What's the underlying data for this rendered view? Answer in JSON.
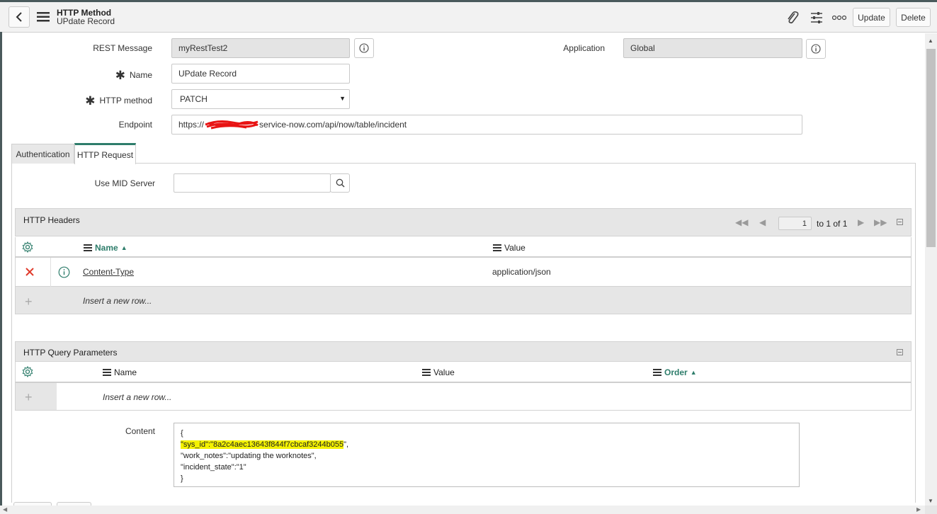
{
  "header": {
    "title": "HTTP Method",
    "subtitle": "UPdate Record",
    "update_label": "Update",
    "delete_label": "Delete"
  },
  "form": {
    "rest_message_label": "REST Message",
    "rest_message_value": "myRestTest2",
    "application_label": "Application",
    "application_value": "Global",
    "name_label": "Name",
    "name_value": "UPdate Record",
    "http_method_label": "HTTP method",
    "http_method_value": "PATCH",
    "endpoint_label": "Endpoint",
    "endpoint_prefix": "https://",
    "endpoint_suffix": "service-now.com/api/now/table/incident"
  },
  "tabs": [
    {
      "label": "Authentication"
    },
    {
      "label": "HTTP Request"
    }
  ],
  "http_request": {
    "mid_server_label": "Use MID Server",
    "mid_server_value": ""
  },
  "headers_section": {
    "title": "HTTP Headers",
    "page_value": "1",
    "page_total": "to 1 of 1",
    "columns": {
      "name": "Name",
      "value": "Value"
    },
    "rows": [
      {
        "name": "Content-Type",
        "value": "application/json"
      }
    ],
    "insert_label": "Insert a new row..."
  },
  "query_section": {
    "title": "HTTP Query Parameters",
    "columns": {
      "name": "Name",
      "value": "Value",
      "order": "Order"
    },
    "insert_label": "Insert a new row..."
  },
  "content": {
    "label": "Content",
    "line1": "{",
    "line2_highlight": "\"sys_id\":\"8a2c4aec13643f844f7cbcaf3244b055",
    "line2_rest": "\",",
    "line3": "\"work_notes\":\"updating the worknotes\",",
    "line4": "\"incident_state\":\"1\"",
    "line5": "}"
  },
  "colors": {
    "accent": "#2e7d6b",
    "delete_x": "#e03a2b",
    "highlight": "#f4f200",
    "redaction": "#e81414"
  }
}
